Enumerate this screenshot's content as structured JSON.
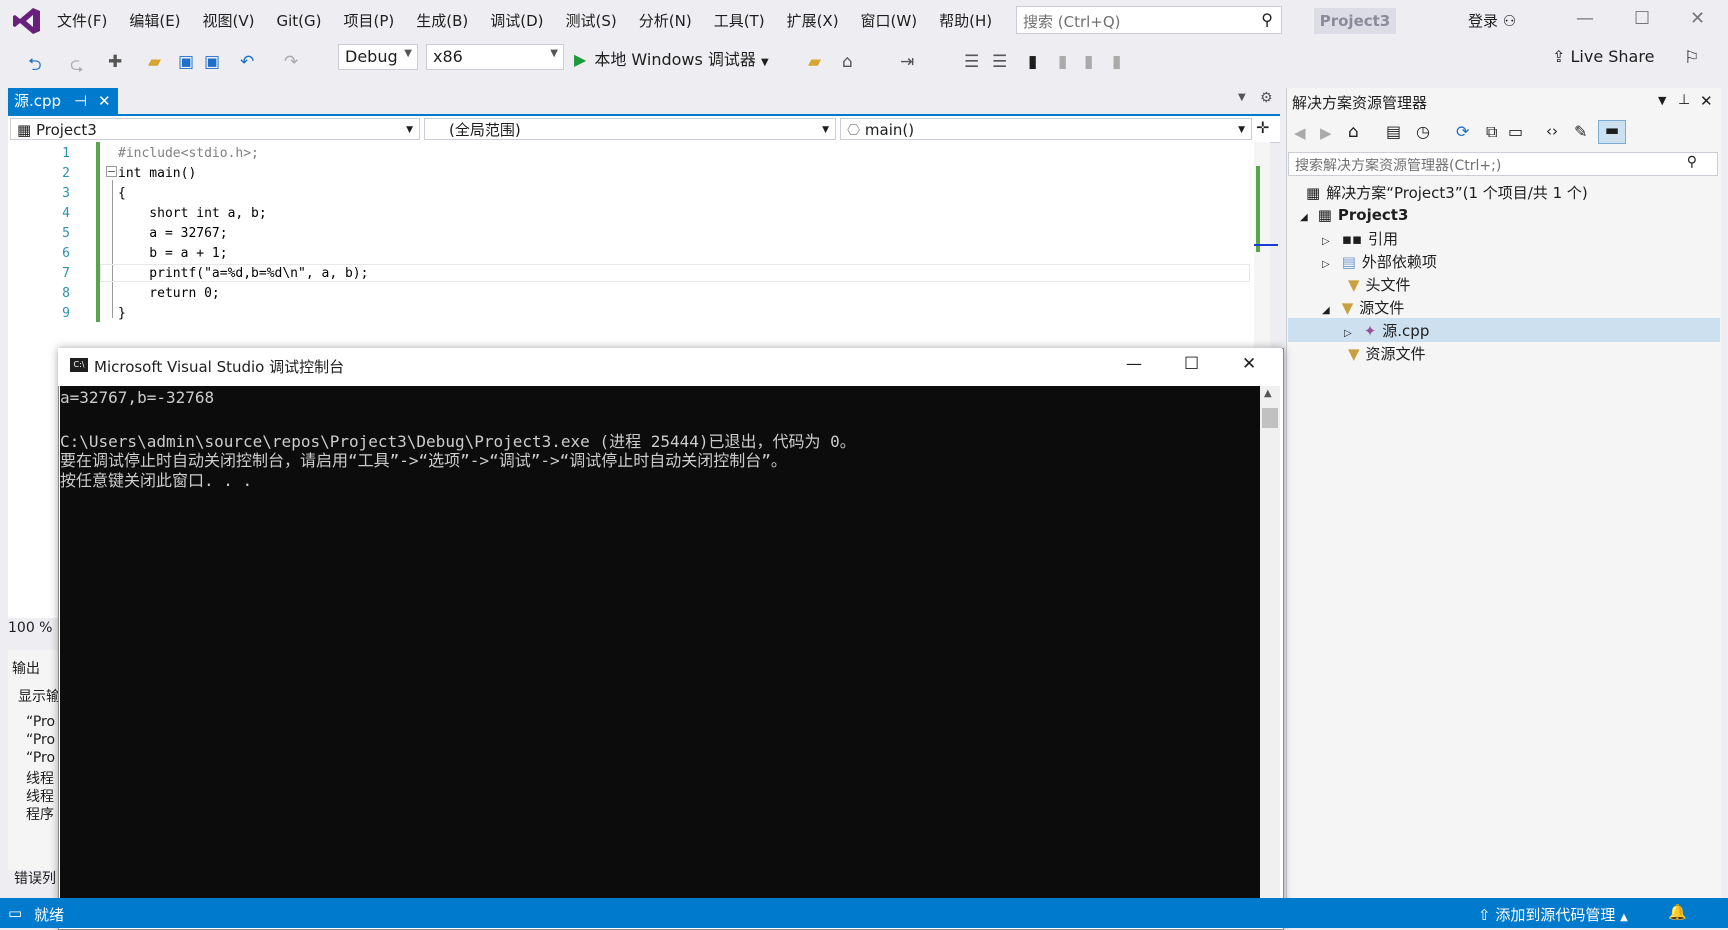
{
  "menu": [
    "文件(F)",
    "编辑(E)",
    "视图(V)",
    "Git(G)",
    "项目(P)",
    "生成(B)",
    "调试(D)",
    "测试(S)",
    "分析(N)",
    "工具(T)",
    "扩展(X)",
    "窗口(W)",
    "帮助(H)"
  ],
  "search_placeholder": "搜索 (Ctrl+Q)",
  "project_badge": "Project3",
  "login": "登录",
  "toolbar": {
    "config": "Debug",
    "platform": "x86",
    "run_label": "本地 Windows 调试器",
    "live_share": "Live Share"
  },
  "editor": {
    "tab_label": "源.cpp",
    "nav_project": "Project3",
    "nav_scope": "(全局范围)",
    "nav_func": "main()",
    "zoom": "100 %",
    "lines": [
      {
        "num": "1",
        "text": "#include<stdio.h>;"
      },
      {
        "num": "2",
        "text": "int main()"
      },
      {
        "num": "3",
        "text": "{"
      },
      {
        "num": "4",
        "text": "    short int a, b;"
      },
      {
        "num": "5",
        "text": "    a = 32767;"
      },
      {
        "num": "6",
        "text": "    b = a + 1;"
      },
      {
        "num": "7",
        "text": "    printf(\"a=%d,b=%d\\n\", a, b);"
      },
      {
        "num": "8",
        "text": "    return 0;"
      },
      {
        "num": "9",
        "text": "}"
      }
    ]
  },
  "output": {
    "title": "输出",
    "lines": [
      "显示输",
      "“Pro",
      "“Pro",
      "“Pro",
      "线程",
      "线程",
      "程序"
    ],
    "error_list": "错误列"
  },
  "solution": {
    "title": "解决方案资源管理器",
    "search_placeholder": "搜索解决方案资源管理器(Ctrl+;)",
    "items": [
      "解决方案“Project3”(1 个项目/共 1 个)",
      "Project3",
      "引用",
      "外部依赖项",
      "头文件",
      "源文件",
      "源.cpp",
      "资源文件"
    ]
  },
  "console": {
    "title": "Microsoft Visual Studio 调试控制台",
    "lines": [
      "a=32767,b=-32768",
      "",
      "C:\\Users\\admin\\source\\repos\\Project3\\Debug\\Project3.exe (进程 25444)已退出，代码为 0。",
      "要在调试停止时自动关闭控制台，请启用“工具”->“选项”->“调试”->“调试停止时自动关闭控制台”。",
      "按任意键关闭此窗口. . ."
    ]
  },
  "status": {
    "ready": "就绪",
    "source_control": "添加到源代码管理"
  }
}
